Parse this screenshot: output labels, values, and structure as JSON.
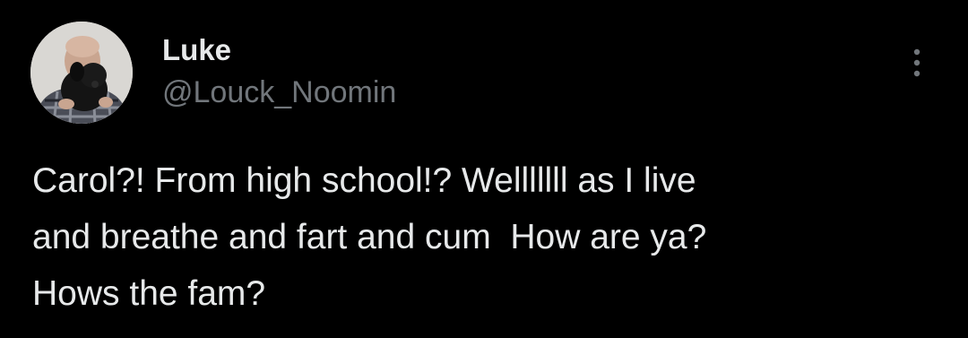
{
  "author": {
    "display_name": "Luke",
    "handle": "@Louck_Noomin",
    "avatar_icon": "avatar-photo-man-holding-dog"
  },
  "menu": {
    "icon": "more-vertical-icon"
  },
  "tweet": {
    "text": "Carol?! From high school!? Welllllll as I live\nand breathe and fart and cum  How are ya?\nHows the fam?"
  },
  "colors": {
    "background": "#000000",
    "primary_text": "#e7e9ea",
    "secondary_text": "#71767b"
  }
}
